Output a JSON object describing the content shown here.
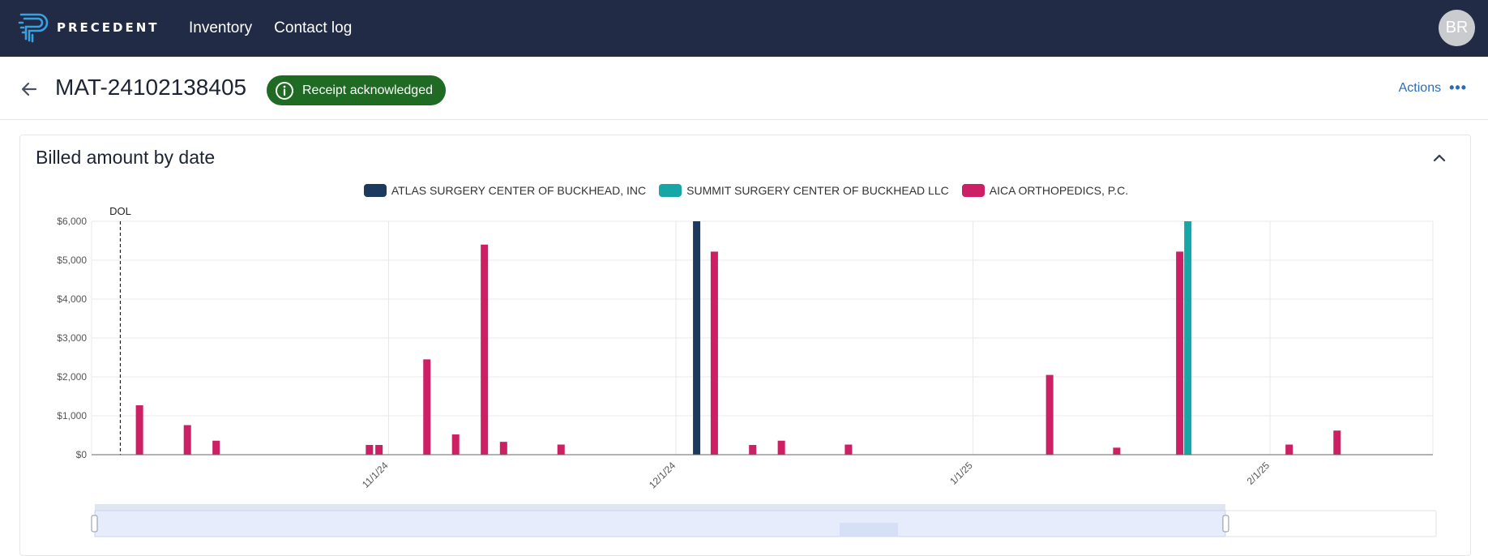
{
  "app": {
    "logo_text": "PRECEDENT",
    "nav": [
      "Inventory",
      "Contact log"
    ],
    "avatar_initials": "BR"
  },
  "header": {
    "matter_id": "MAT-24102138405",
    "status": "Receipt acknowledged",
    "actions_label": "Actions"
  },
  "panel": {
    "title": "Billed amount by date"
  },
  "colors": {
    "nav_bg": "#222b45",
    "status_green": "#1f6b23",
    "link_blue": "#2b6db3",
    "atlas": "#1b3a5e",
    "summit": "#17a6a6",
    "aica": "#cc1f64"
  },
  "chart_data": {
    "type": "bar",
    "title": "Billed amount by date",
    "ylim": [
      0,
      6000
    ],
    "y_ticks": [
      "$0",
      "$1,000",
      "$2,000",
      "$3,000",
      "$4,000",
      "$5,000",
      "$6,000"
    ],
    "x_range": [
      "2024-10-01",
      "2025-02-18"
    ],
    "x_ticks": [
      {
        "date": "2024-11-01",
        "label": "11/1/24"
      },
      {
        "date": "2024-12-01",
        "label": "12/1/24"
      },
      {
        "date": "2025-01-01",
        "label": "1/1/25"
      },
      {
        "date": "2025-02-01",
        "label": "2/1/25"
      }
    ],
    "annotation": {
      "date": "2024-10-04",
      "label": "DOL"
    },
    "grid": true,
    "legend_position": "top-center",
    "series": [
      {
        "name": "ATLAS SURGERY CENTER OF BUCKHEAD, INC",
        "color": "#1b3a5e",
        "points": [
          {
            "date": "2024-12-04",
            "value": 6000
          }
        ]
      },
      {
        "name": "SUMMIT SURGERY CENTER OF BUCKHEAD LLC",
        "color": "#17a6a6",
        "points": [
          {
            "date": "2025-01-23",
            "value": 6000
          }
        ]
      },
      {
        "name": "AICA ORTHOPEDICS, P.C.",
        "color": "#cc1f64",
        "points": [
          {
            "date": "2024-10-06",
            "value": 1270
          },
          {
            "date": "2024-10-11",
            "value": 760
          },
          {
            "date": "2024-10-14",
            "value": 360
          },
          {
            "date": "2024-10-30",
            "value": 250
          },
          {
            "date": "2024-10-31",
            "value": 250
          },
          {
            "date": "2024-11-05",
            "value": 2450
          },
          {
            "date": "2024-11-08",
            "value": 520
          },
          {
            "date": "2024-11-11",
            "value": 5400
          },
          {
            "date": "2024-11-13",
            "value": 330
          },
          {
            "date": "2024-11-19",
            "value": 260
          },
          {
            "date": "2024-12-05",
            "value": 5220
          },
          {
            "date": "2024-12-09",
            "value": 250
          },
          {
            "date": "2024-12-12",
            "value": 360
          },
          {
            "date": "2024-12-19",
            "value": 260
          },
          {
            "date": "2025-01-09",
            "value": 2050
          },
          {
            "date": "2025-01-16",
            "value": 180
          },
          {
            "date": "2025-01-23",
            "value": 5220
          },
          {
            "date": "2025-02-03",
            "value": 260
          },
          {
            "date": "2025-02-08",
            "value": 620
          }
        ]
      }
    ],
    "brush": {
      "selected_start": "2024-10-01",
      "selected_end": "2025-01-27"
    }
  }
}
